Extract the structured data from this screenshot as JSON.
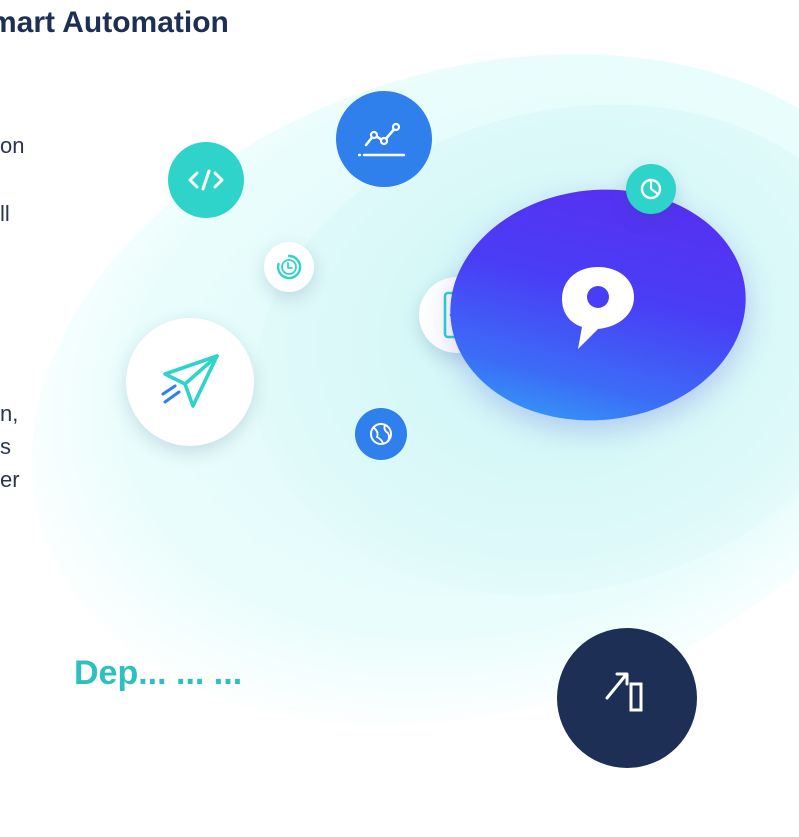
{
  "header": {
    "title": "mart Automation"
  },
  "text_fragments": [
    "on",
    "ll",
    "n,",
    "s",
    "er"
  ],
  "bottom_fragment": "Dep... ... ...",
  "colors": {
    "navy": "#1d2f55",
    "teal": "#2ed3c9",
    "blue": "#2f80ed",
    "purple": "#5b2cf0",
    "cyan_light": "#dcfbfa"
  },
  "icons": [
    "code-icon",
    "analytics-icon",
    "clock-icon",
    "mobile-app-icon",
    "paper-plane-icon",
    "globe-icon",
    "pie-chart-icon",
    "growth-chart-icon",
    "brand-logo-icon"
  ]
}
